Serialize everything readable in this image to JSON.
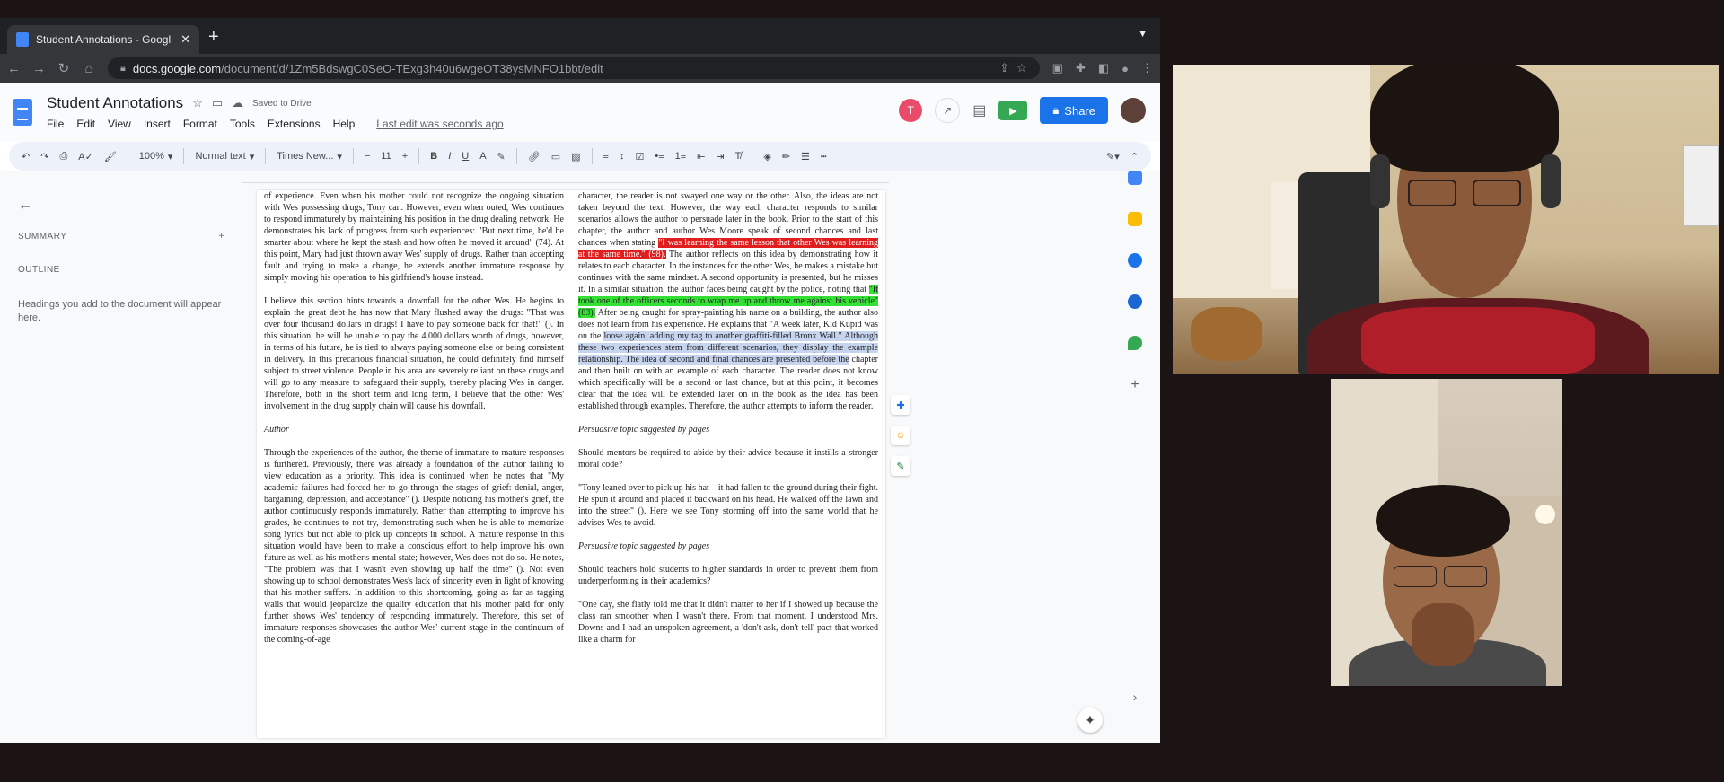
{
  "browser": {
    "tab_title": "Student Annotations - Googl",
    "url_host": "docs.google.com",
    "url_path": "/document/d/1Zm5BdswgC0SeO-TExg3h40u6wgeOT38ysMNFO1bbt/edit"
  },
  "docs": {
    "title": "Student Annotations",
    "saved_status": "Saved to Drive",
    "menus": [
      "File",
      "Edit",
      "View",
      "Insert",
      "Format",
      "Tools",
      "Extensions",
      "Help"
    ],
    "last_edit": "Last edit was seconds ago",
    "avatar_initial": "T",
    "share_label": "Share"
  },
  "toolbar": {
    "zoom": "100%",
    "style": "Normal text",
    "font": "Times New...",
    "font_size": "11"
  },
  "outline": {
    "summary_label": "SUMMARY",
    "outline_label": "OUTLINE",
    "outline_hint": "Headings you add to the document will appear here."
  },
  "document": {
    "left_p1": "of experience. Even when his mother could not recognize the ongoing situation with Wes possessing drugs, Tony can. However, even when outed, Wes continues to respond immaturely by maintaining his position in the drug dealing network. He demonstrates his lack of progress from such experiences: \"But next time, he'd be smarter about where he kept the stash and how often he moved it around\" (74). At this point, Mary had just thrown away Wes' supply of drugs. Rather than accepting fault and trying to make a change, he extends another immature response by simply moving his operation to his girlfriend's house instead.",
    "left_p2": "I believe this section hints towards a downfall for the other Wes. He begins to explain the great debt he has now that Mary flushed away the drugs: \"That was over four thousand dollars in drugs! I have to pay someone back for that!\" (). In this situation, he will be unable to pay the 4,000 dollars worth of drugs, however, in terms of his future, he is tied to always paying someone else or being consistent in delivery. In this precarious financial situation, he could definitely find himself subject to street violence. People in his area are severely reliant on these drugs and will go to any measure to safeguard their supply, thereby placing Wes in danger. Therefore, both in the short term and long term, I believe that the other Wes' involvement in the drug supply chain will cause his downfall.",
    "left_head": "Author",
    "left_p3": "Through the experiences of the author, the theme of immature to mature responses is furthered. Previously, there was already a foundation of the author failing to view education as a priority. This idea is continued when he notes that \"My academic failures had forced her to go through the stages of grief: denial, anger, bargaining, depression, and acceptance\" (). Despite noticing his mother's grief, the author continuously responds immaturely. Rather than attempting to improve his grades, he continues to not try, demonstrating such when he is able to memorize song lyrics but not able to pick up concepts in school. A mature response in this situation would have been to make a conscious effort to help improve his own future as well as his mother's mental state; however, Wes does not do so. He notes, \"The problem was that I wasn't even showing up half the time\" (). Not even showing up to school demonstrates Wes's lack of sincerity even in light of knowing that his mother suffers. In addition to this shortcoming, going as far as tagging walls that would jeopardize the quality education that his mother paid for only further shows Wes' tendency of responding immaturely. Therefore, this set of immature responses showcases the author Wes' current stage in the continuum of the coming-of-age",
    "right_a": "character, the reader is not swayed one way or the other. Also, the ideas are not taken beyond the text. However, the way each character responds to similar scenarios allows the author to persuade later in the book. Prior to the start of this chapter, the author and author Wes Moore speak of second chances and last chances when stating",
    "right_red": "\"I was learning the same lesson that other Wes was learning at the same time.\" (98).",
    "right_b": " The author reflects on this idea by demonstrating how it relates to each character. In the instances for the other Wes, he makes a mistake but continues with the same mindset. A second opportunity is presented, but he misses it. In a similar situation, the author faces being caught by the police, noting that ",
    "right_green": "\"It took one of the officers seconds to wrap me up and throw me against his vehicle\" (83).",
    "right_c": " After being caught for spray-painting his name on a building, the author also does not learn from his experience. He explains that \"A week later, Kid Kupid was on the ",
    "right_blue": "loose again, adding my tag to another graffiti-filled Bronx Wall.\" Although these two experiences stem from different scenarios, they display the example relationship. The idea of second and final chances are presented before the",
    "right_d": " chapter and then built on with an example of each character. The reader does not know which specifically will be a second or last chance, but at this point, it becomes clear that the idea will be extended later on in the book as the idea has been established through examples. Therefore, the author attempts to inform the reader.",
    "right_head1": "Persuasive topic suggested by pages",
    "right_q1": "Should mentors be required to abide by their advice because it instills a stronger moral code?",
    "right_quote1": "\"Tony leaned over to pick up his hat—it had fallen to the ground during their fight. He spun it around and placed it backward on his head. He walked off the lawn and into the street\" (). Here we see Tony storming off into the same world that he advises Wes to avoid.",
    "right_head2": "Persuasive topic suggested by pages",
    "right_q2": "Should teachers hold students to higher standards in order to prevent them from underperforming in their academics?",
    "right_quote2": "\"One day, she flatly told me that it didn't matter to her if I showed up because the class ran smoother when I wasn't there. From that moment, I understood Mrs. Downs and I had an unspoken agreement, a 'don't ask, don't tell' pact that worked like a charm for"
  },
  "colors": {
    "red_highlight": "#e01e1e",
    "green_highlight": "#33e033",
    "blue_selection": "#c6d4ee",
    "share_blue": "#1a73e8"
  }
}
